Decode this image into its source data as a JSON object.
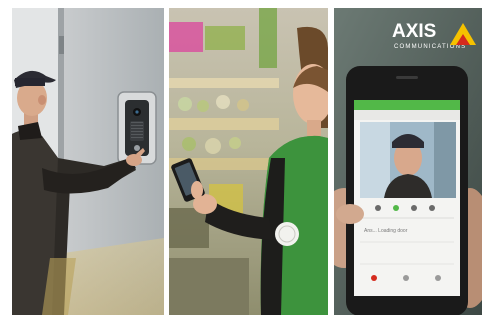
{
  "brand": {
    "name": "AXIS",
    "tagline": "COMMUNICATIONS",
    "colors": {
      "yellow": "#f6c200",
      "red": "#d52b1e",
      "white": "#ffffff"
    }
  },
  "panels": [
    {
      "id": "door-entry",
      "subject": "courier pressing intercom button on door station"
    },
    {
      "id": "retail-store",
      "subject": "store employee in green vest using smartphone"
    },
    {
      "id": "mobile-video",
      "subject": "smartphone showing live video of visitor"
    }
  ],
  "phone_screen": {
    "status_text": "Ans... Loading door",
    "header_color": "#52b848"
  }
}
